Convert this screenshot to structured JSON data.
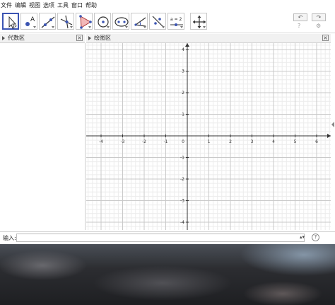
{
  "menu": [
    "文件",
    "编辑",
    "视图",
    "选项",
    "工具",
    "窗口",
    "帮助"
  ],
  "tools": [
    {
      "name": "move-tool",
      "icon": "cursor-icon"
    },
    {
      "name": "point-tool",
      "icon": "point-a-icon"
    },
    {
      "name": "line-tool",
      "icon": "line-icon"
    },
    {
      "name": "perpendicular-tool",
      "icon": "perpendicular-line-icon"
    },
    {
      "name": "polygon-tool",
      "icon": "polygon-icon"
    },
    {
      "name": "circle-tool",
      "icon": "circle-center-icon"
    },
    {
      "name": "ellipse-tool",
      "icon": "ellipse-icon"
    },
    {
      "name": "angle-tool",
      "icon": "angle-icon"
    },
    {
      "name": "reflect-tool",
      "icon": "reflect-icon"
    },
    {
      "name": "slider-tool",
      "icon": "slider-icon",
      "label": "a = 2"
    },
    {
      "name": "move-graphics-tool",
      "icon": "move-view-icon"
    }
  ],
  "algebra_panel": {
    "title": "代数区"
  },
  "graphics_panel": {
    "title": "绘图区"
  },
  "axes": {
    "x_ticks": [
      "-4",
      "-3",
      "-2",
      "-1",
      "0",
      "1",
      "2",
      "3",
      "4",
      "5",
      "6"
    ],
    "y_ticks": [
      "4",
      "3",
      "2",
      "1",
      "-1",
      "-2",
      "-3",
      "-4"
    ]
  },
  "input_bar": {
    "label": "输入:",
    "help": "?",
    "spinner": "▴▾",
    "value": ""
  },
  "undo": "↶",
  "redo": "↷",
  "help_icon": "?",
  "settings_icon": "⚙",
  "close_glyph": "×"
}
